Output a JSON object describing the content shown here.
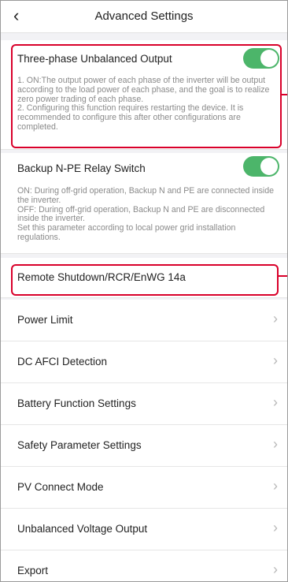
{
  "header": {
    "title": "Advanced Settings",
    "back_icon": "chevron-left-icon"
  },
  "three_phase": {
    "title": "Three-phase Unbalanced Output",
    "enabled": true,
    "description": [
      "1. ON:The output power of each phase of the inverter will be output according to the load power of each phase, and the goal is to realize zero power trading of each phase.",
      "2. Configuring this function requires restarting the device. It is recommended to configure this after other configurations are completed."
    ]
  },
  "backup_relay": {
    "title": "Backup N-PE Relay Switch",
    "enabled": true,
    "description": [
      "ON: During off-grid operation, Backup N and PE are connected inside the inverter.",
      "OFF: During off-grid operation, Backup N and PE are disconnected inside the inverter.",
      "Set this parameter according to local power grid installation regulations."
    ]
  },
  "menu": [
    {
      "label": "Remote Shutdown/RCR/EnWG 14a",
      "chevron": false
    },
    {
      "label": "Power Limit",
      "chevron": true
    },
    {
      "label": "DC AFCI Detection",
      "chevron": true
    },
    {
      "label": "Battery Function Settings",
      "chevron": true
    },
    {
      "label": "Safety Parameter Settings",
      "chevron": true
    },
    {
      "label": "PV Connect Mode",
      "chevron": true
    },
    {
      "label": "Unbalanced Voltage Output",
      "chevron": true
    },
    {
      "label": "Export",
      "chevron": true
    }
  ],
  "colors": {
    "toggle_on": "#4cb56a",
    "highlight": "#d9002a",
    "chevron": "#b8b8b8"
  }
}
